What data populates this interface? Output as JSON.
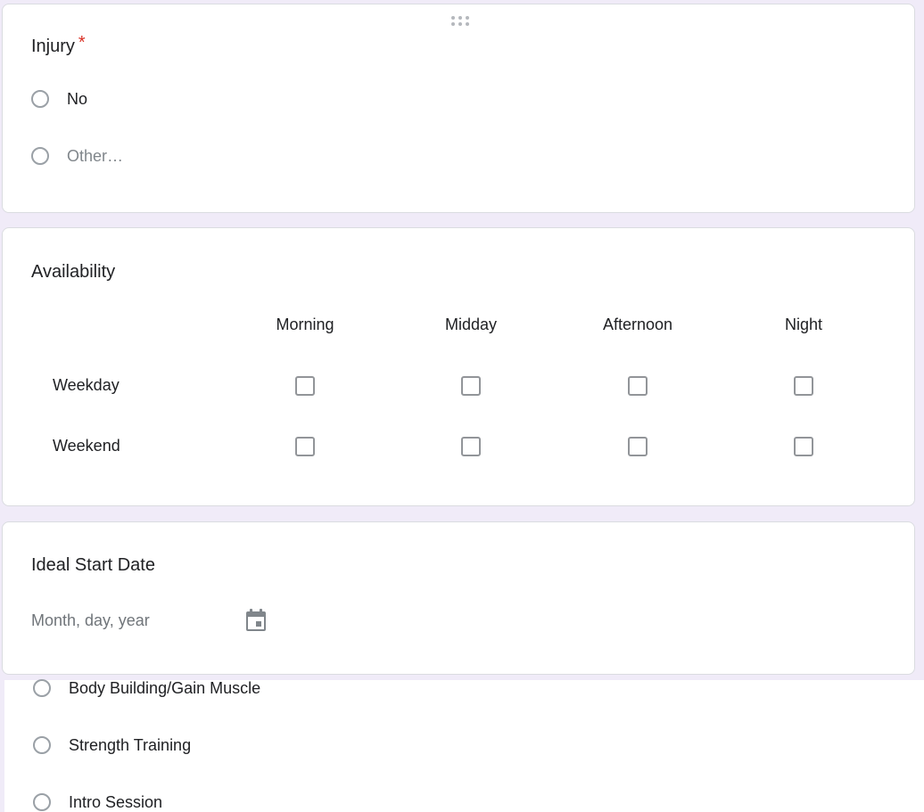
{
  "injury": {
    "title": "Injury",
    "required_marker": "*",
    "options": [
      {
        "label": "No"
      },
      {
        "label": "Other…"
      }
    ]
  },
  "availability": {
    "title": "Availability",
    "columns": [
      "Morning",
      "Midday",
      "Afternoon",
      "Night"
    ],
    "rows": [
      "Weekday",
      "Weekend"
    ]
  },
  "start_date": {
    "title": "Ideal Start Date",
    "placeholder": "Month, day, year",
    "icon": "calendar-icon"
  },
  "service": {
    "options": [
      {
        "label": "Body Building/Gain Muscle"
      },
      {
        "label": "Strength Training"
      },
      {
        "label": "Intro Session"
      }
    ]
  },
  "colors": {
    "page_background": "#f0ebf8",
    "card_background": "#ffffff",
    "required": "#d93025",
    "control_border": "#9aa0a6"
  }
}
